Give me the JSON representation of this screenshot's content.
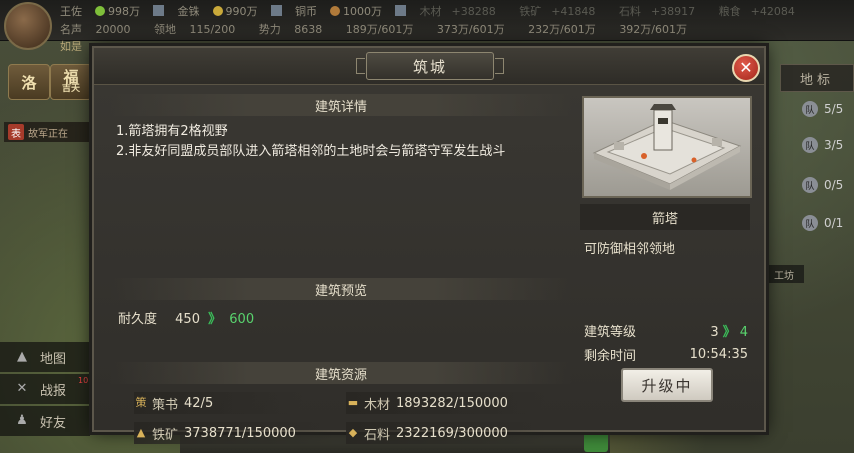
{
  "hud": {
    "player_name": "如是",
    "row1": [
      {
        "label": "王佐",
        "value": "998万",
        "icon": "green-coin"
      },
      {
        "label": "金铢",
        "value": "990万",
        "icon": "gold-coin"
      },
      {
        "label": "铜币",
        "value": "1000万",
        "icon": "copper-coin"
      },
      {
        "label": "木材",
        "value": "+38288"
      },
      {
        "label": "铁矿",
        "value": "+41848"
      },
      {
        "label": "石料",
        "value": "+38917"
      },
      {
        "label": "粮食",
        "value": "+42084"
      }
    ],
    "row2": [
      {
        "label": "名声",
        "value": "20000"
      },
      {
        "label": "领地",
        "value": "115/200"
      },
      {
        "label": "势力",
        "value": "8638"
      },
      {
        "label": "",
        "value": "189万/601万"
      },
      {
        "label": "",
        "value": "373万/601万"
      },
      {
        "label": "",
        "value": "232万/601万"
      },
      {
        "label": "",
        "value": "392万/601万"
      }
    ]
  },
  "left_menu": {
    "btn1": "洛",
    "btn2": "福",
    "btn2_sub": "吉天",
    "notice_icon": "表",
    "notice": "故军正在",
    "items": [
      {
        "icon": "map-icon",
        "glyph": "▲",
        "label": "地图"
      },
      {
        "icon": "battle-report-icon",
        "glyph": "✕",
        "label": "战报",
        "badge": "10"
      },
      {
        "icon": "friends-icon",
        "glyph": "♟",
        "label": "好友"
      }
    ]
  },
  "right_menu": {
    "tab": "地标",
    "troops": [
      {
        "badge": "队",
        "value": "5/5"
      },
      {
        "badge": "队",
        "value": "3/5"
      },
      {
        "badge": "队",
        "value": "0/5"
      },
      {
        "badge": "队",
        "value": "0/1"
      }
    ],
    "worksite": "工坊"
  },
  "modal": {
    "title": "筑城",
    "close_glyph": "✕",
    "details_heading": "建筑详情",
    "details": [
      "1.箭塔拥有2格视野",
      "2.非友好同盟成员部队进入箭塔相邻的土地时会与箭塔守军发生战斗"
    ],
    "preview_heading": "建筑预览",
    "durability_label": "耐久度",
    "durability_current": "450",
    "durability_next": "600",
    "arrow": "》",
    "resources_heading": "建筑资源",
    "resources": [
      {
        "icon": "policy-book-icon",
        "glyph": "策",
        "label": "策书",
        "value": "42/5"
      },
      {
        "icon": "wood-icon",
        "glyph": "▬",
        "label": "木材",
        "value": "1893282/150000"
      },
      {
        "icon": "iron-icon",
        "glyph": "▲",
        "label": "铁矿",
        "value": "3738771/150000"
      },
      {
        "icon": "stone-icon",
        "glyph": "◆",
        "label": "石料",
        "value": "2322169/300000"
      }
    ],
    "building_name": "箭塔",
    "building_desc": "可防御相邻领地",
    "level_label": "建筑等级",
    "level_current": "3",
    "level_next": "4",
    "time_label": "剩余时间",
    "time_value": "10:54:35",
    "upgrade_button": "升级中"
  }
}
